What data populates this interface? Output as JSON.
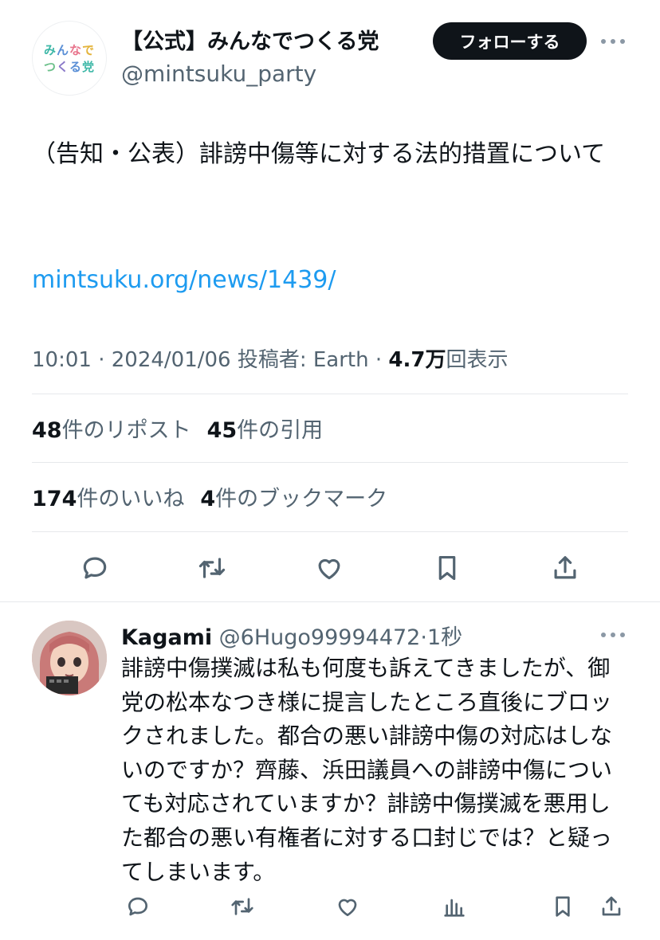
{
  "account": {
    "display_name": "【公式】みんなでつくる党",
    "handle": "@mintsuku_party",
    "logo_line1": "みんなで",
    "logo_line2": "つくる党",
    "follow_label": "フォローする"
  },
  "tweet": {
    "text": "（告知・公表）誹謗中傷等に対する法的措置について",
    "link": "mintsuku.org/news/1439/",
    "time": "10:01",
    "date": "2024/01/06",
    "posted_by_label": "投稿者: Earth",
    "views_count": "4.7万",
    "views_label": "回表示",
    "separator": "·"
  },
  "stats": {
    "reposts_count": "48",
    "reposts_label": "件のリポスト",
    "quotes_count": "45",
    "quotes_label": "件の引用",
    "likes_count": "174",
    "likes_label": "件のいいね",
    "bookmarks_count": "4",
    "bookmarks_label": "件のブックマーク"
  },
  "actions": [
    "reply-icon",
    "repost-icon",
    "like-icon",
    "bookmark-icon",
    "share-icon"
  ],
  "reply": {
    "name": "Kagami",
    "handle": "@6Hugo99994472",
    "separator": "·",
    "time": "1秒",
    "text": "誹謗中傷撲滅は私も何度も訴えてきましたが、御党の松本なつき様に提言したところ直後にブロックされました。都合の悪い誹謗中傷の対応はしないのですか？齊藤、浜田議員への誹謗中傷についても対応されていますか？誹謗中傷撲滅を悪用した都合の悪い有権者に対する口封じでは？と疑ってしまいます。"
  },
  "colors": {
    "link": "#1d9bf0",
    "muted": "#536471",
    "text": "#0f1419",
    "button_bg": "#0f1419"
  }
}
